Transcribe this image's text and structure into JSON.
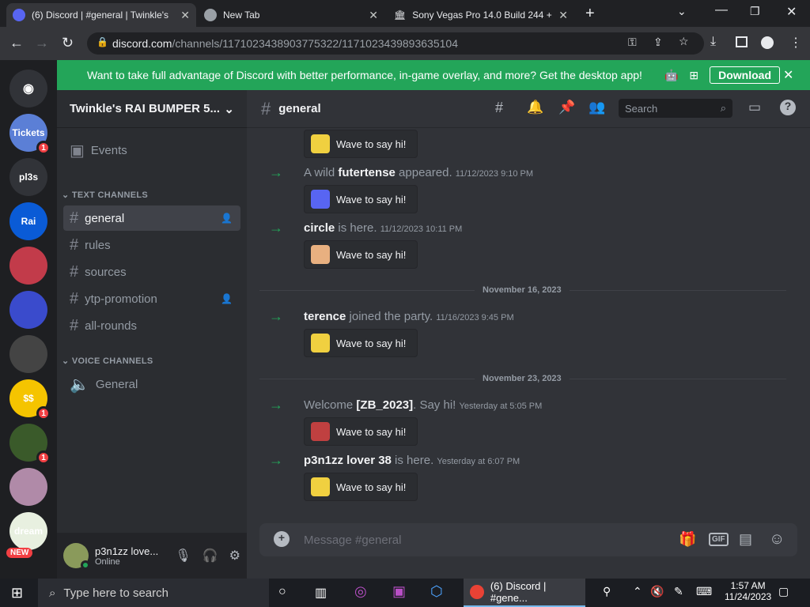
{
  "tabs": [
    {
      "label": "(6) Discord | #general | Twinkle's",
      "active": true
    },
    {
      "label": "New Tab"
    },
    {
      "label": "Sony Vegas Pro 14.0 Build 244 +"
    }
  ],
  "url": {
    "host": "discord.com",
    "path": "/channels/1171023438903775322/1171023439893635104"
  },
  "banner": {
    "text": "Want to take full advantage of Discord with better performance, in-game overlay, and more? Get the desktop app!",
    "button": "Download"
  },
  "guilds": [
    {
      "label": "Tickets",
      "color": "#5b7fd6",
      "badge": "1"
    },
    {
      "label": "pl3s",
      "color": "#313338"
    },
    {
      "label": "Rai",
      "color": "#0a5bd6"
    },
    {
      "label": "",
      "color": "#c23b4a"
    },
    {
      "label": "",
      "color": "#3a4bcc"
    },
    {
      "label": "",
      "color": "#444"
    },
    {
      "label": "$$",
      "color": "#f5c400",
      "badge": "1"
    },
    {
      "label": "",
      "color": "#3a5a2a",
      "badge": "1"
    },
    {
      "label": "",
      "color": "#b08aa8"
    },
    {
      "label": "dream",
      "color": "#e8f0e0",
      "new": "NEW"
    }
  ],
  "server": {
    "name": "Twinkle's RAI BUMPER 5..."
  },
  "events": "Events",
  "text_cat": "TEXT CHANNELS",
  "channels": [
    "general",
    "rules",
    "sources",
    "ytp-promotion",
    "all-rounds"
  ],
  "voice_cat": "VOICE CHANNELS",
  "voice": [
    "General"
  ],
  "user": {
    "name": "p3n1zz love...",
    "status": "Online"
  },
  "channel": "general",
  "search": "Search",
  "messages": [
    {
      "pre": "A wild ",
      "name": "futertense",
      "post": " appeared.",
      "ts": "11/12/2023 9:10 PM"
    },
    {
      "pre": "",
      "name": "circle",
      "post": " is here.",
      "ts": "11/12/2023 10:11 PM"
    },
    {
      "pre": "",
      "name": "terence",
      "post": " joined the party.",
      "ts": "11/16/2023 9:45 PM"
    },
    {
      "pre": "Welcome ",
      "name": "[ZB_2023]",
      "post": ". Say hi!",
      "ts": "Yesterday at 5:05 PM"
    },
    {
      "pre": "",
      "name": "p3n1zz lover 38",
      "post": " is here.",
      "ts": "Yesterday at 6:07 PM"
    }
  ],
  "wave": "Wave to say hi!",
  "dividers": [
    "November 16, 2023",
    "November 23, 2023"
  ],
  "composer": "Message #general",
  "taskbar": {
    "search": "Type here to search",
    "app": "(6) Discord | #gene...",
    "time": "1:57 AM",
    "date": "11/24/2023"
  }
}
